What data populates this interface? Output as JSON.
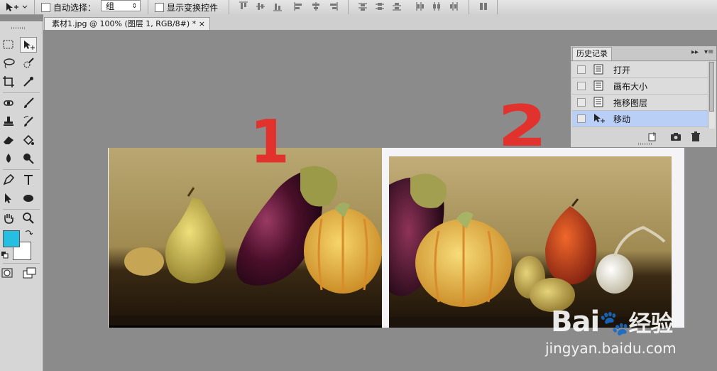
{
  "options_bar": {
    "auto_select_label": "自动选择：",
    "auto_select_value": "组",
    "show_transform_label": "显示变换控件"
  },
  "document": {
    "tab_title": "素材1.jpg @ 100% (图层 1, RGB/8#) *",
    "close_glyph": "×"
  },
  "history_panel": {
    "tab_label": "历史记录",
    "items": [
      {
        "label": "打开",
        "icon": "document-icon"
      },
      {
        "label": "画布大小",
        "icon": "document-icon"
      },
      {
        "label": "拖移图层",
        "icon": "document-icon"
      },
      {
        "label": "移动",
        "icon": "move-tool-icon"
      }
    ],
    "active_index": 3,
    "menu_glyph": "▸▸",
    "menu_glyph2": "▾≡"
  },
  "annotations": {
    "mark_1": "1",
    "mark_2": "2"
  },
  "colors": {
    "foreground": "#26bfe2",
    "background": "#ffffff",
    "annotation": "#e2322d",
    "history_selected": "#b9cff5"
  },
  "watermark": {
    "brand": "Bai",
    "brand_suffix": "经验",
    "url": "jingyan.baidu.com"
  }
}
